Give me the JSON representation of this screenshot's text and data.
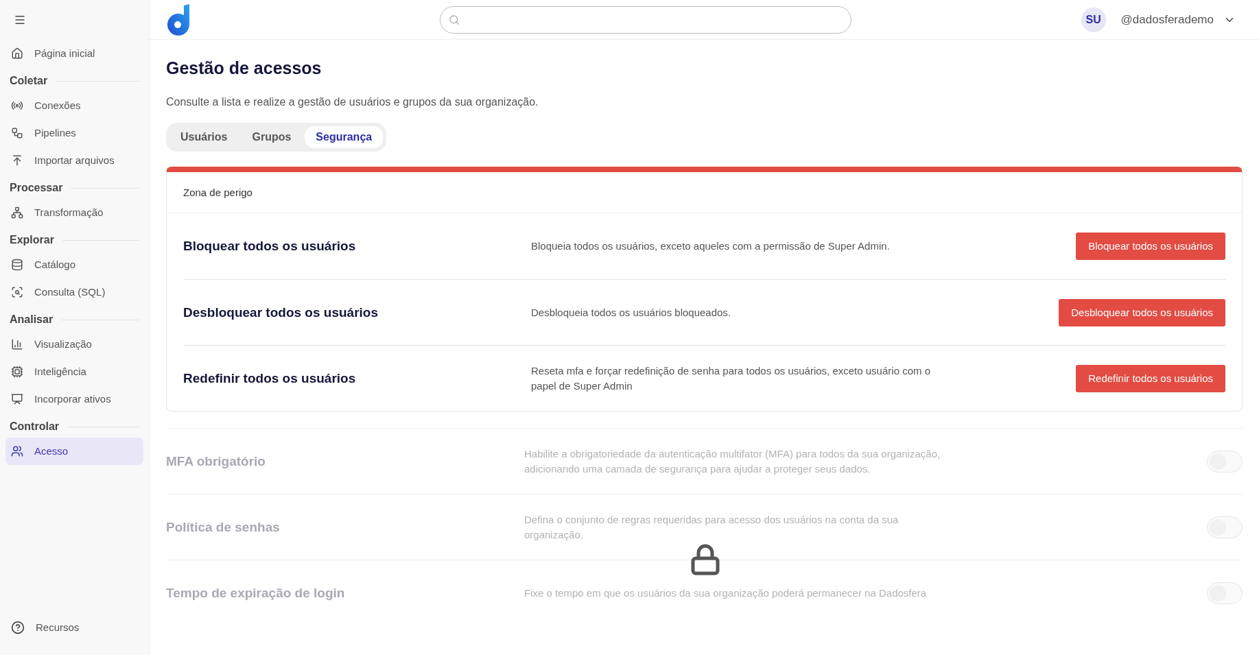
{
  "sidebar": {
    "items": [
      {
        "kind": "item",
        "label": "Página inicial",
        "selected": false
      },
      {
        "kind": "section",
        "label": "Coletar"
      },
      {
        "kind": "item",
        "label": "Conexões",
        "selected": false
      },
      {
        "kind": "item",
        "label": "Pipelines",
        "selected": false
      },
      {
        "kind": "item",
        "label": "Importar arquivos",
        "selected": false
      },
      {
        "kind": "section",
        "label": "Processar"
      },
      {
        "kind": "item",
        "label": "Transformação",
        "selected": false
      },
      {
        "kind": "section",
        "label": "Explorar"
      },
      {
        "kind": "item",
        "label": "Catálogo",
        "selected": false
      },
      {
        "kind": "item",
        "label": "Consulta (SQL)",
        "selected": false
      },
      {
        "kind": "section",
        "label": "Analisar"
      },
      {
        "kind": "item",
        "label": "Visualização",
        "selected": false
      },
      {
        "kind": "item",
        "label": "Inteligência",
        "selected": false
      },
      {
        "kind": "item",
        "label": "Incorporar ativos",
        "selected": false
      },
      {
        "kind": "section",
        "label": "Controlar"
      },
      {
        "kind": "item",
        "label": "Acesso",
        "selected": true
      }
    ],
    "footer": "Recursos"
  },
  "topbar": {
    "avatar": "SU",
    "user": "@dadosferademo"
  },
  "page": {
    "title": "Gestão de acessos",
    "description": "Consulte a lista e realize a gestão de usuários e grupos da sua organização."
  },
  "tabs": [
    {
      "label": "Usuários",
      "selected": false
    },
    {
      "label": "Grupos",
      "selected": false
    },
    {
      "label": "Segurança",
      "selected": true
    }
  ],
  "danger_zone": {
    "title": "Zona de perigo",
    "rows": [
      {
        "title": "Bloquear todos os usuários",
        "description": "Bloqueia todos os usuários, exceto aqueles com a permissão de Super Admin.",
        "button": "Bloquear todos os usuários"
      },
      {
        "title": "Desbloquear todos os usuários",
        "description": "Desbloqueia todos os usuários bloqueados.",
        "button": "Desbloquear todos os usuários"
      },
      {
        "title": "Redefinir todos os usuários",
        "description": "Reseta mfa e forçar redefinição de senha para todos os usuários, exceto usuário com o papel de Super Admin",
        "button": "Redefinir todos os usuários"
      }
    ]
  },
  "settings": [
    {
      "title": "MFA obrigatório",
      "description": "Habilite a obrigatoriedade da autenticação multifator (MFA) para todos da sua organização, adicionando uma camada de segurança para ajudar a proteger seus dados.",
      "on": false,
      "disabled": true
    },
    {
      "title": "Política de senhas",
      "description": "Defina o conjunto de regras requeridas para acesso dos usuários na conta da sua organização.",
      "on": false,
      "disabled": true
    },
    {
      "title": "Tempo de expiração de login",
      "description": "Fixe o tempo em que os usuários da sua organização poderá permanecer na Dadosfera",
      "on": false,
      "disabled": true
    }
  ]
}
